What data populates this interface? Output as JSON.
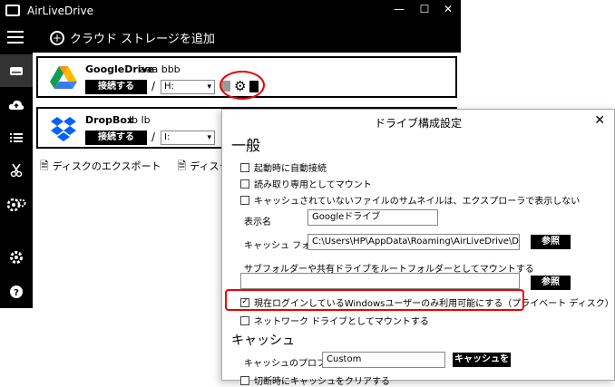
{
  "app": {
    "title": "AirLiveDrive",
    "minimize": "—",
    "maximize": "☐",
    "close": "✕",
    "add_cloud_label": "クラウド ストレージを追加"
  },
  "drives": [
    {
      "name": "GoogleDrive",
      "user": "aaa bbb",
      "connect_label": "接続する",
      "slash": "/",
      "drive_letter": "H:"
    },
    {
      "name": "DropBox",
      "user": "lb lb",
      "connect_label": "接続する",
      "slash": "/",
      "drive_letter": "I:"
    }
  ],
  "links": {
    "export_label": "ディスクのエクスポート",
    "import_label": "ディスクのインポート"
  },
  "dialog": {
    "title": "ドライブ構成設定",
    "close": "✕",
    "general_heading": "一般",
    "chk_autoconnect": "起動時に自動接続",
    "chk_readonly": "読み取り専用としてマウント",
    "chk_thumbnails": "キャッシュされていないファイルのサムネイルは、エクスプローラで表示しない",
    "display_name_label": "表示名",
    "display_name_value": "Googleドライブ",
    "cache_folder_label": "キャッシュ フォルダ",
    "cache_folder_value": "C:\\Users\\HP\\AppData\\Roaming\\AirLiveDrive\\DisksCache\\Air",
    "browse_label": "参照",
    "subfolder_label": "サブフォルダーや共有ドライブをルートフォルダーとしてマウントする",
    "subfolder_value": "",
    "browse_label_2": "参照",
    "chk_current_user": "現在ログインしているWindowsユーザーのみ利用可能にする（プライベート ディスク）",
    "chk_network": "ネットワーク ドライブとしてマウントする",
    "cache_heading": "キャッシュ",
    "cache_profile_label": "キャッシュのプロファイル",
    "cache_profile_value": "Custom",
    "clear_cache_label": "キャッシュをクリア",
    "chk_clear_on_disconnect": "切断時にキャッシュをクリアする"
  }
}
